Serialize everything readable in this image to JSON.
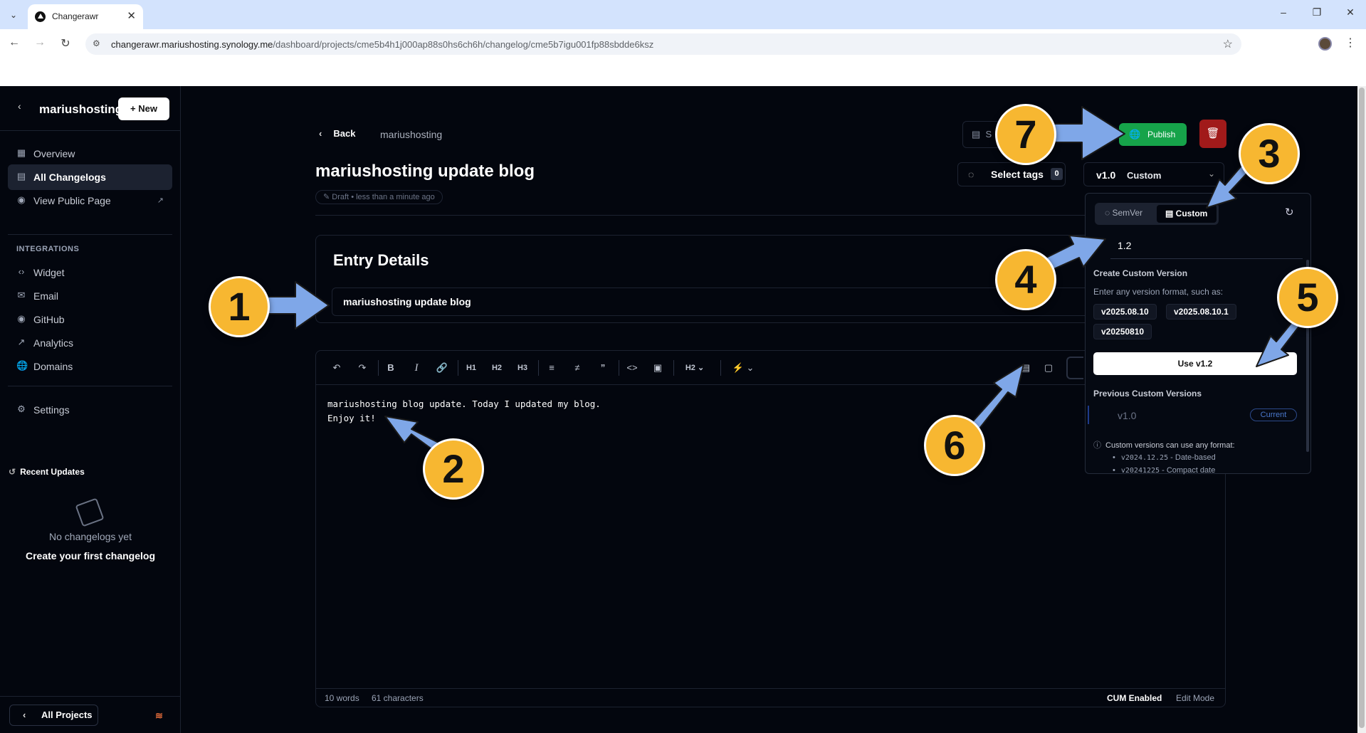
{
  "browser": {
    "tab_title": "Changerawr",
    "url_host": "changerawr.mariushosting.synology.me",
    "url_path": "/dashboard/projects/cme5b4h1j000ap88s0hs6ch6h/changelog/cme5b7igu001fp88sbdde6ksz"
  },
  "sidebar": {
    "project_name": "mariushosting",
    "new_label": "New",
    "items": [
      {
        "label": "Overview",
        "icon": "grid-icon"
      },
      {
        "label": "All Changelogs",
        "icon": "document-icon"
      },
      {
        "label": "View Public Page",
        "icon": "eye-icon"
      }
    ],
    "integrations_heading": "INTEGRATIONS",
    "integrations": [
      {
        "label": "Widget",
        "icon": "code-icon"
      },
      {
        "label": "Email",
        "icon": "mail-icon"
      },
      {
        "label": "GitHub",
        "icon": "github-icon"
      },
      {
        "label": "Analytics",
        "icon": "chart-icon"
      },
      {
        "label": "Domains",
        "icon": "globe-icon"
      }
    ],
    "settings_label": "Settings",
    "recent_heading": "Recent Updates",
    "empty_title": "No changelogs yet",
    "empty_cta": "Create your first changelog",
    "all_projects_label": "All Projects"
  },
  "header": {
    "back_label": "Back",
    "breadcrumb_project": "mariushosting",
    "title": "mariushosting update blog",
    "status": "Draft",
    "updated": "• less than a minute ago",
    "save_label": "S",
    "publish_label": "Publish",
    "tags_label": "Select tags",
    "tags_count": "0",
    "version": "v1.0",
    "version_mode": "Custom"
  },
  "entry": {
    "heading": "Entry Details",
    "title_value": "mariushosting update blog"
  },
  "editor": {
    "content": "mariushosting blog update. Today I updated my blog.\nEnjoy it!",
    "toolbar_heading_select": "H2",
    "words": "10 words",
    "chars": "61 characters",
    "cum_status": "CUM Enabled",
    "mode": "Edit Mode"
  },
  "version_popover": {
    "tab_semver": "SemVer",
    "tab_custom": "Custom",
    "input_value": "1.2",
    "create_heading": "Create Custom Version",
    "create_sub": "Enter any version format, such as:",
    "examples": [
      "v2025.08.10",
      "v2025.08.10.1",
      "v20250810"
    ],
    "use_label": "Use v1.2",
    "prev_heading": "Previous Custom Versions",
    "prev_version": "v1.0",
    "current_label": "Current",
    "info": "Custom versions can use any format:",
    "formats": [
      {
        "code": "v2024.12.25",
        "desc": "- Date-based"
      },
      {
        "code": "v20241225",
        "desc": "- Compact date"
      }
    ]
  },
  "annotations": [
    "1",
    "2",
    "3",
    "4",
    "5",
    "6",
    "7"
  ],
  "colors": {
    "background": "#03060e",
    "publish": "#16a34a",
    "delete": "#a11a1a",
    "badge": "#f7b731",
    "arrow": "#7fa7e8"
  }
}
